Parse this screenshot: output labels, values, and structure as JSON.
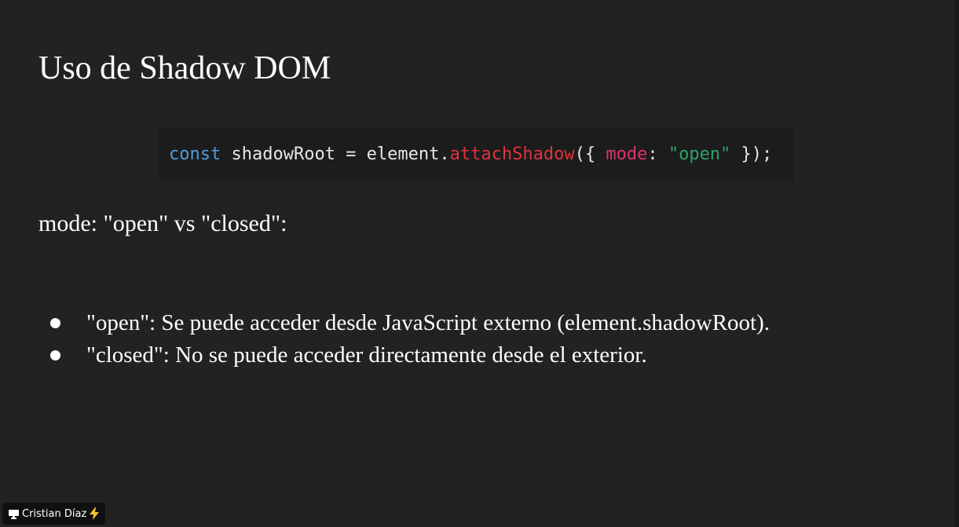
{
  "slide": {
    "title": "Uso de Shadow DOM",
    "code": {
      "tokens": [
        {
          "text": "const",
          "kind": "keyword"
        },
        {
          "text": " shadowRoot = element.",
          "kind": "plain"
        },
        {
          "text": "attachShadow",
          "kind": "func"
        },
        {
          "text": "({ ",
          "kind": "plain"
        },
        {
          "text": "mode",
          "kind": "prop"
        },
        {
          "text": ": ",
          "kind": "plain"
        },
        {
          "text": "\"open\"",
          "kind": "string"
        },
        {
          "text": " });",
          "kind": "plain"
        }
      ],
      "colors": {
        "plain": "#e6e6e6",
        "keyword": "#4f9ce0",
        "func": "#e0333b",
        "prop": "#e0316e",
        "string": "#2fa36b"
      }
    },
    "subheading": "mode: \"open\" vs \"closed\":",
    "bullets": [
      "\"open\": Se puede acceder desde JavaScript externo (element.shadowRoot).",
      "\"closed\": No se puede acceder directamente desde el exterior."
    ]
  },
  "presenter": {
    "name": "Cristian Díaz",
    "icon": "monitor-icon",
    "trailing_icon": "lightning-icon",
    "trailing_color": "#f2c230"
  }
}
